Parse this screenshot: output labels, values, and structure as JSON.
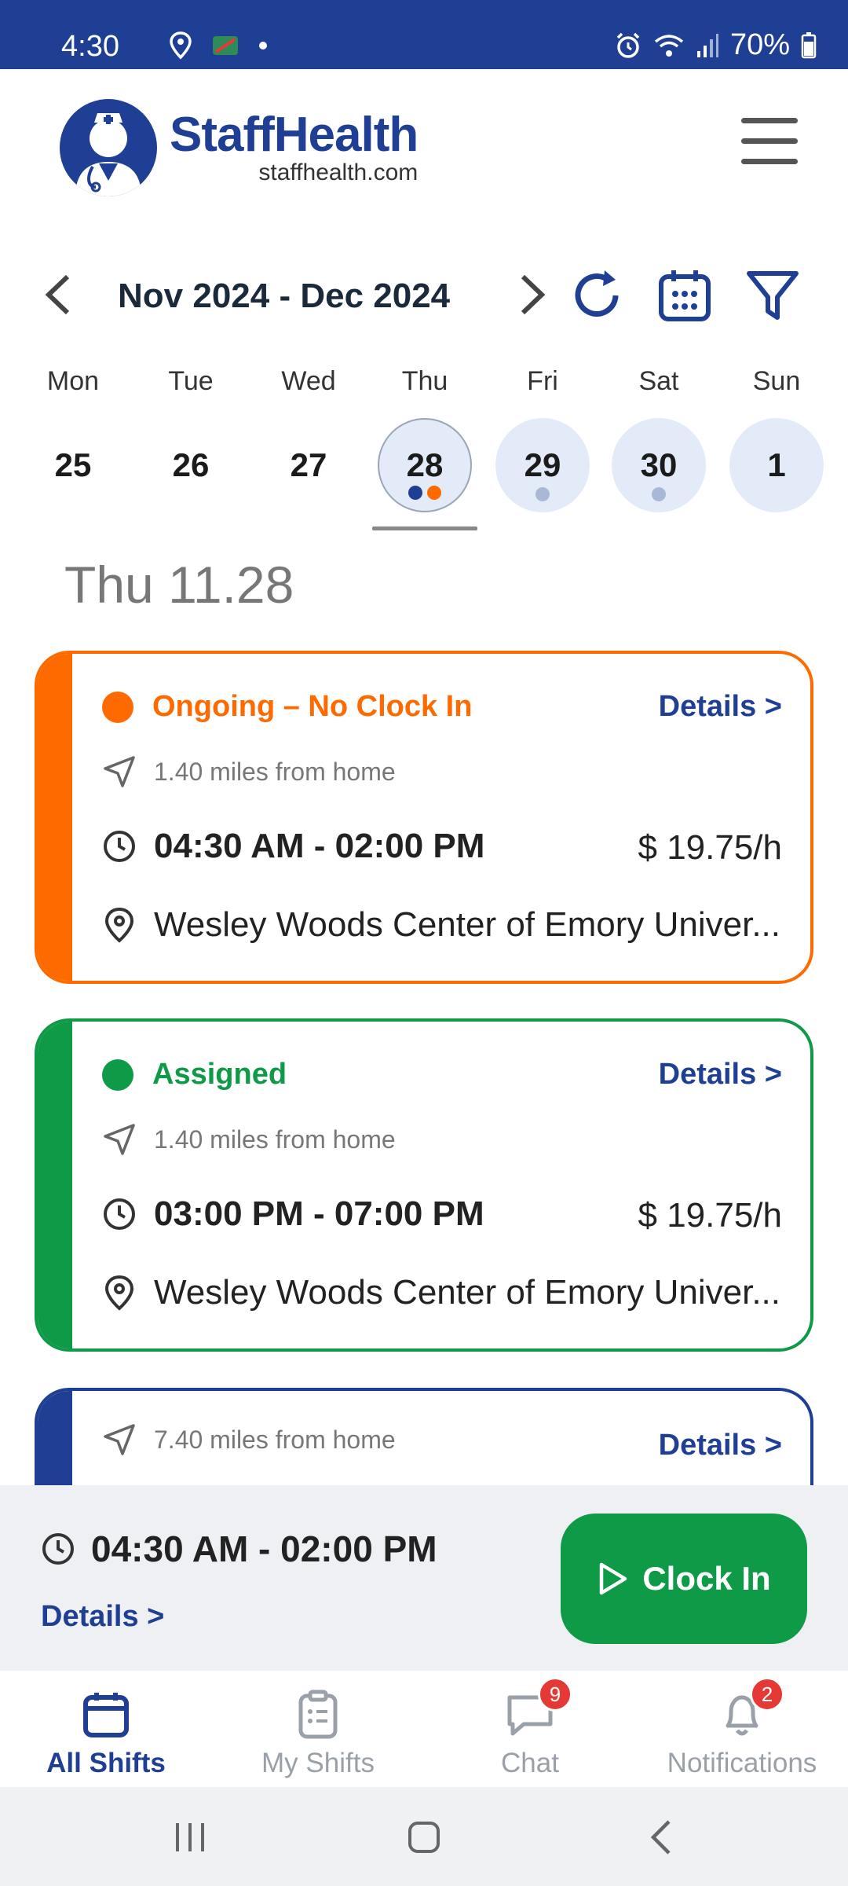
{
  "status_bar": {
    "time": "4:30",
    "battery": "70%"
  },
  "header": {
    "brand": "StaffHealth",
    "url": "staffhealth.com"
  },
  "date_nav": {
    "range": "Nov 2024 - Dec 2024"
  },
  "week": [
    {
      "name": "Mon",
      "num": "25"
    },
    {
      "name": "Tue",
      "num": "26"
    },
    {
      "name": "Wed",
      "num": "27"
    },
    {
      "name": "Thu",
      "num": "28"
    },
    {
      "name": "Fri",
      "num": "29"
    },
    {
      "name": "Sat",
      "num": "30"
    },
    {
      "name": "Sun",
      "num": "1"
    }
  ],
  "selected_day_heading": "Thu 11.28",
  "shifts": [
    {
      "status": "Ongoing – No Clock In",
      "details": "Details >",
      "distance": "1.40 miles from home",
      "time": "04:30 AM - 02:00 PM",
      "rate": "$ 19.75/h",
      "location": "Wesley Woods Center of Emory Univer...",
      "color": "#ff6a00"
    },
    {
      "status": "Assigned",
      "details": "Details >",
      "distance": "1.40 miles from home",
      "time": "03:00 PM - 07:00 PM",
      "rate": "$ 19.75/h",
      "location": "Wesley Woods Center of Emory Univer...",
      "color": "#0e9a47"
    },
    {
      "details": "Details >",
      "distance": "7.40 miles from home",
      "color": "#1f3f94"
    }
  ],
  "active_shift": {
    "time": "04:30 AM - 02:00 PM",
    "details": "Details >",
    "clock_in": "Clock In"
  },
  "bottom_nav": [
    {
      "label": "All Shifts",
      "icon": "calendar-icon",
      "active": true
    },
    {
      "label": "My Shifts",
      "icon": "clipboard-icon",
      "active": false
    },
    {
      "label": "Chat",
      "icon": "chat-icon",
      "badge": "9",
      "active": false
    },
    {
      "label": "Notifications",
      "icon": "bell-icon",
      "badge": "2",
      "active": false
    }
  ],
  "colors": {
    "brand": "#1f3f94",
    "ongoing": "#ff6a00",
    "assigned": "#0e9a47",
    "dot_blue": "#1f3f94",
    "dot_orange": "#ff6a00",
    "dot_light": "#aab8d8"
  }
}
